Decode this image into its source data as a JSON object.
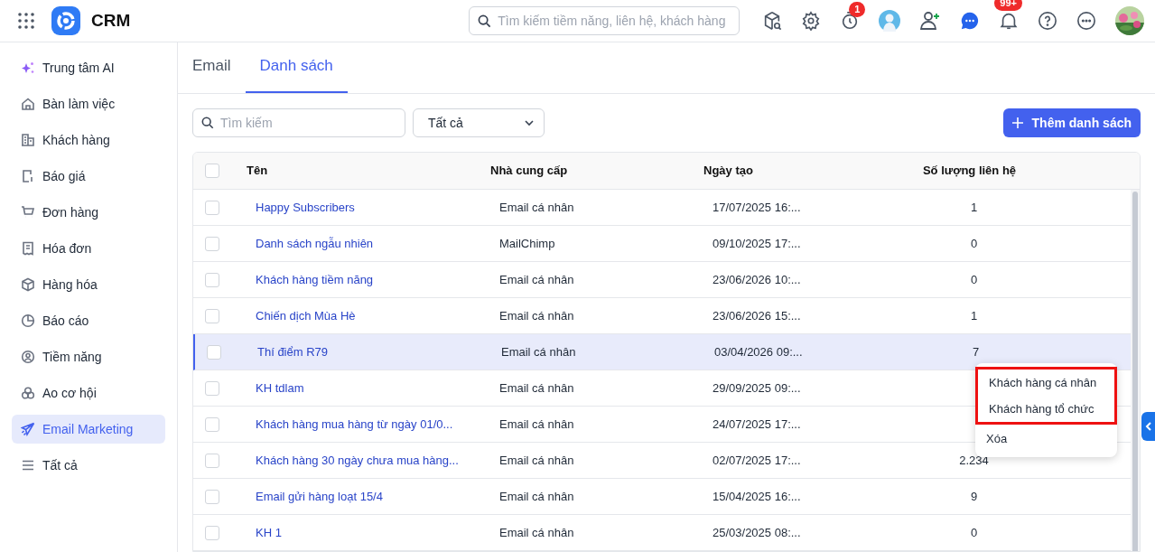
{
  "app": {
    "title": "CRM"
  },
  "header": {
    "search_placeholder": "Tìm kiếm tiềm năng, liên hệ, khách hàng",
    "timer_badge": "1",
    "notification_badge": "99+"
  },
  "sidebar": {
    "items": [
      {
        "label": "Trung tâm AI",
        "selected": false
      },
      {
        "label": "Bàn làm việc",
        "selected": false
      },
      {
        "label": "Khách hàng",
        "selected": false
      },
      {
        "label": "Báo giá",
        "selected": false
      },
      {
        "label": "Đơn hàng",
        "selected": false
      },
      {
        "label": "Hóa đơn",
        "selected": false
      },
      {
        "label": "Hàng hóa",
        "selected": false
      },
      {
        "label": "Báo cáo",
        "selected": false
      },
      {
        "label": "Tiềm năng",
        "selected": false
      },
      {
        "label": "Ao cơ hội",
        "selected": false
      },
      {
        "label": "Email Marketing",
        "selected": true
      },
      {
        "label": "Tất cả",
        "selected": false
      }
    ]
  },
  "tabs": [
    {
      "label": "Email",
      "selected": false
    },
    {
      "label": "Danh sách",
      "selected": true
    }
  ],
  "toolbar": {
    "search_placeholder": "Tìm kiếm",
    "filter_value": "Tất cả",
    "add_button": "Thêm danh sách"
  },
  "table": {
    "all_checked": false,
    "columns": [
      "Tên",
      "Nhà cung cấp",
      "Ngày tạo",
      "Số lượng liên hệ"
    ],
    "rows": [
      {
        "name": "Happy Subscribers",
        "provider": "Email cá nhân",
        "created": "17/07/2025 16:...",
        "count": "1",
        "checked": false,
        "selected": false
      },
      {
        "name": "Danh sách ngẫu nhiên",
        "provider": "MailChimp",
        "created": "09/10/2025 17:...",
        "count": "0",
        "checked": false,
        "selected": false
      },
      {
        "name": "Khách hàng tiềm năng",
        "provider": "Email cá nhân",
        "created": "23/06/2026 10:...",
        "count": "0",
        "checked": false,
        "selected": false
      },
      {
        "name": "Chiến dịch Mùa Hè",
        "provider": "Email cá nhân",
        "created": "23/06/2026 15:...",
        "count": "1",
        "checked": false,
        "selected": false
      },
      {
        "name": "Thí điểm R79",
        "provider": "Email cá nhân",
        "created": "03/04/2026 09:...",
        "count": "7",
        "checked": false,
        "selected": true
      },
      {
        "name": "KH tdlam",
        "provider": "Email cá nhân",
        "created": "29/09/2025 09:...",
        "checked": false,
        "selected": false
      },
      {
        "name": "Khách hàng mua hàng từ ngày 01/0...",
        "provider": "Email cá nhân",
        "created": "24/07/2025 17:...",
        "checked": false,
        "selected": false
      },
      {
        "name": "Khách hàng 30 ngày chưa mua hàng...",
        "provider": "Email cá nhân",
        "created": "02/07/2025 17:...",
        "count": "2.234",
        "checked": false,
        "selected": false
      },
      {
        "name": "Email gửi hàng loạt 15/4",
        "provider": "Email cá nhân",
        "created": "15/04/2025 16:...",
        "count": "9",
        "checked": false,
        "selected": false
      },
      {
        "name": "KH 1",
        "provider": "Email cá nhân",
        "created": "25/03/2025 08:...",
        "count": "0",
        "checked": false,
        "selected": false
      }
    ]
  },
  "context_menu": {
    "items": [
      {
        "label": "Khách hàng cá nhân",
        "highlighted": true
      },
      {
        "label": "Khách hàng tổ chức",
        "highlighted": true
      },
      {
        "label": "Xóa",
        "highlighted": false
      }
    ]
  }
}
